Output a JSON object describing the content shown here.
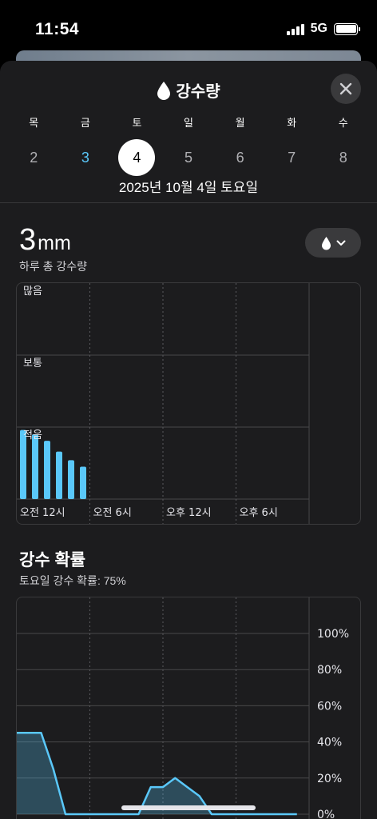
{
  "status": {
    "time": "11:54",
    "network": "5G"
  },
  "sheet": {
    "title": "강수량",
    "days": [
      {
        "name": "목",
        "num": "2",
        "state": "normal"
      },
      {
        "name": "금",
        "num": "3",
        "state": "today"
      },
      {
        "name": "토",
        "num": "4",
        "state": "selected"
      },
      {
        "name": "일",
        "num": "5",
        "state": "normal"
      },
      {
        "name": "월",
        "num": "6",
        "state": "normal"
      },
      {
        "name": "화",
        "num": "7",
        "state": "normal"
      },
      {
        "name": "수",
        "num": "8",
        "state": "normal"
      }
    ],
    "date_label": "2025년 10월 4일 토요일"
  },
  "total": {
    "value": "3",
    "unit": "mm",
    "subtitle": "하루 총 강수량"
  },
  "probability": {
    "title": "강수 확률",
    "subtitle": "토요일 강수 확률: 75%"
  },
  "colors": {
    "accent": "#5ac8fa",
    "background": "#1c1c1e"
  },
  "chart_data": [
    {
      "type": "bar",
      "title": "",
      "y_levels": [
        "많음",
        "보통",
        "적음"
      ],
      "x_tick_labels": [
        "오전 12시",
        "오전 6시",
        "오후 12시",
        "오후 6시"
      ],
      "x_hours": [
        0,
        1,
        2,
        3,
        4,
        5
      ],
      "values": [
        0.32,
        0.3,
        0.27,
        0.22,
        0.18,
        0.15
      ],
      "ylim": [
        0,
        1
      ]
    },
    {
      "type": "area",
      "title": "",
      "y_tick_labels": [
        "100%",
        "80%",
        "60%",
        "40%",
        "20%",
        "0%"
      ],
      "ylim": [
        0,
        100
      ],
      "x": [
        0,
        2,
        3,
        4,
        5,
        6,
        7,
        8,
        9,
        10,
        11,
        12,
        13,
        14,
        15,
        16,
        17,
        18,
        19,
        20,
        21,
        22,
        23
      ],
      "y": [
        45,
        45,
        25,
        0,
        0,
        0,
        0,
        0,
        0,
        0,
        15,
        15,
        20,
        15,
        10,
        0,
        0,
        0,
        0,
        0,
        0,
        0,
        0
      ]
    }
  ]
}
